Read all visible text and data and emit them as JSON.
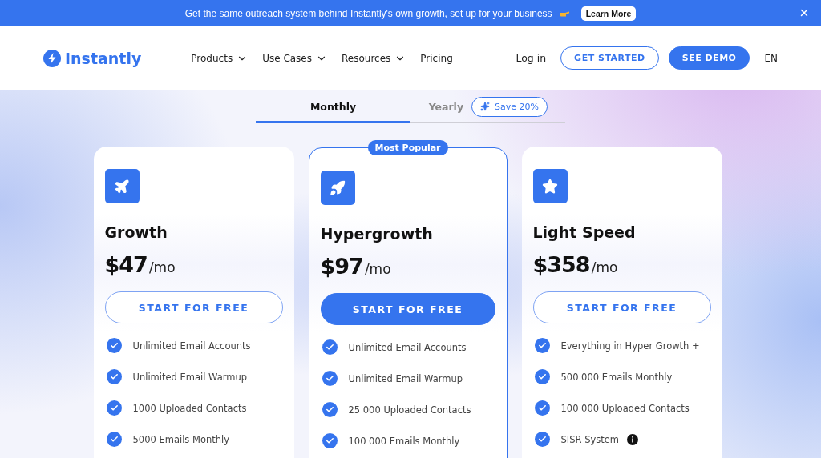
{
  "banner": {
    "text": "Get the same outreach system behind Instantly's own growth, set up for your business",
    "button": "Learn More"
  },
  "nav": {
    "logo": "Instantly",
    "menu": [
      {
        "label": "Products",
        "dropdown": true
      },
      {
        "label": "Use Cases",
        "dropdown": true
      },
      {
        "label": "Resources",
        "dropdown": true
      },
      {
        "label": "Pricing",
        "dropdown": false
      }
    ],
    "login": "Log in",
    "get_started": "GET STARTED",
    "demo": "SEE DEMO",
    "language": "EN"
  },
  "billing": {
    "tabs": [
      {
        "label": "Monthly",
        "selected": true
      },
      {
        "label": "Yearly",
        "selected": false
      }
    ],
    "save_badge": "Save 20%"
  },
  "plans": [
    {
      "name": "Growth",
      "kind": "plane",
      "featured": false,
      "price": "$47",
      "period": "/mo",
      "button": "START FOR FREE",
      "features": [
        {
          "text": "Unlimited Email Accounts",
          "info": false
        },
        {
          "text": "Unlimited Email Warmup",
          "info": false
        },
        {
          "text": "1000 Uploaded Contacts",
          "info": false
        },
        {
          "text": "5000 Emails Monthly",
          "info": false
        }
      ]
    },
    {
      "name": "Hypergrowth",
      "kind": "rocket",
      "featured": true,
      "badge": "Most Popular",
      "price": "$97",
      "period": "/mo",
      "button": "START FOR FREE",
      "features": [
        {
          "text": "Unlimited Email Accounts",
          "info": false
        },
        {
          "text": "Unlimited Email Warmup",
          "info": false
        },
        {
          "text": "25 000 Uploaded Contacts",
          "info": false
        },
        {
          "text": "100 000 Emails Monthly",
          "info": false
        }
      ]
    },
    {
      "name": "Light Speed",
      "kind": "star",
      "featured": false,
      "price": "$358",
      "period": "/mo",
      "button": "START FOR FREE",
      "features": [
        {
          "text": "Everything in Hyper Growth +",
          "info": false
        },
        {
          "text": "500 000 Emails Monthly",
          "info": false
        },
        {
          "text": "100 000 Uploaded Contacts",
          "info": false
        },
        {
          "text": "SISR System",
          "info": true
        }
      ]
    }
  ]
}
